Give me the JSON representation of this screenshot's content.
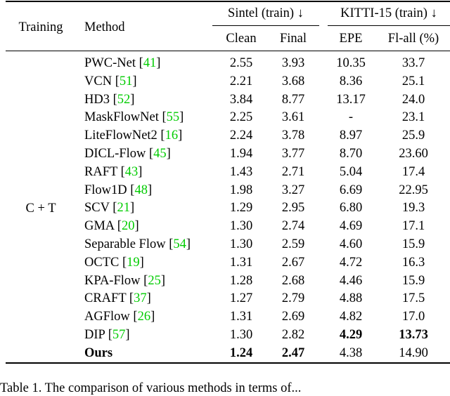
{
  "table": {
    "headers": {
      "training": "Training",
      "method": "Method",
      "sintel_group": "Sintel (train) ↓",
      "kitti_group": "KITTI-15 (train) ↓",
      "clean": "Clean",
      "final": "Final",
      "epe": "EPE",
      "fl_all": "Fl-all (%)"
    },
    "training_label": "C + T",
    "rows": [
      {
        "method": "PWC-Net",
        "cite": "41",
        "clean": "2.55",
        "final": "3.93",
        "epe": "10.35",
        "fl_all": "33.7"
      },
      {
        "method": "VCN",
        "cite": "51",
        "clean": "2.21",
        "final": "3.68",
        "epe": "8.36",
        "fl_all": "25.1"
      },
      {
        "method": "HD3",
        "cite": "52",
        "clean": "3.84",
        "final": "8.77",
        "epe": "13.17",
        "fl_all": "24.0"
      },
      {
        "method": "MaskFlowNet",
        "cite": "55",
        "clean": "2.25",
        "final": "3.61",
        "epe": "-",
        "fl_all": "23.1"
      },
      {
        "method": "LiteFlowNet2",
        "cite": "16",
        "clean": "2.24",
        "final": "3.78",
        "epe": "8.97",
        "fl_all": "25.9"
      },
      {
        "method": "DICL-Flow",
        "cite": "45",
        "clean": "1.94",
        "final": "3.77",
        "epe": "8.70",
        "fl_all": "23.60"
      },
      {
        "method": "RAFT",
        "cite": "43",
        "clean": "1.43",
        "final": "2.71",
        "epe": "5.04",
        "fl_all": "17.4"
      },
      {
        "method": "Flow1D",
        "cite": "48",
        "clean": "1.98",
        "final": "3.27",
        "epe": "6.69",
        "fl_all": "22.95"
      },
      {
        "method": "SCV",
        "cite": "21",
        "clean": "1.29",
        "final": "2.95",
        "epe": "6.80",
        "fl_all": "19.3"
      },
      {
        "method": "GMA",
        "cite": "20",
        "clean": "1.30",
        "final": "2.74",
        "epe": "4.69",
        "fl_all": "17.1"
      },
      {
        "method": "Separable Flow",
        "cite": "54",
        "clean": "1.30",
        "final": "2.59",
        "epe": "4.60",
        "fl_all": "15.9"
      },
      {
        "method": "OCTC",
        "cite": "19",
        "clean": "1.31",
        "final": "2.67",
        "epe": "4.72",
        "fl_all": "16.3"
      },
      {
        "method": "KPA-Flow",
        "cite": "25",
        "clean": "1.28",
        "final": "2.68",
        "epe": "4.46",
        "fl_all": "15.9"
      },
      {
        "method": "CRAFT",
        "cite": "37",
        "clean": "1.27",
        "final": "2.79",
        "epe": "4.88",
        "fl_all": "17.5"
      },
      {
        "method": "AGFlow",
        "cite": "26",
        "clean": "1.31",
        "final": "2.69",
        "epe": "4.82",
        "fl_all": "17.0"
      },
      {
        "method": "DIP",
        "cite": "57",
        "clean": "1.30",
        "final": "2.82",
        "epe": "4.29",
        "fl_all": "13.73"
      },
      {
        "method": "Ours",
        "cite": "",
        "clean": "1.24",
        "final": "2.47",
        "epe": "4.38",
        "fl_all": "14.90"
      }
    ]
  },
  "caption": "Table 1. The comparison of various methods in terms of... "
}
